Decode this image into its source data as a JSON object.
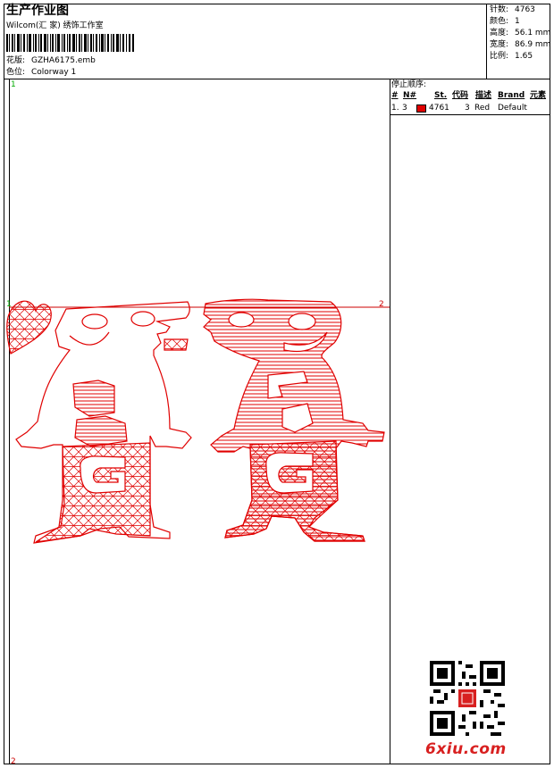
{
  "header": {
    "title": "生产作业图",
    "studio": "Wilcom(汇 家) 绣饰工作室",
    "design_label": "花版:",
    "design_file": "GZHA6175.emb",
    "colorway_label": "色位:",
    "colorway_value": "Colorway 1"
  },
  "stats": [
    {
      "label": "针数:",
      "value": "4763"
    },
    {
      "label": "颜色:",
      "value": "1"
    },
    {
      "label": "高度:",
      "value": "56.1 mm"
    },
    {
      "label": "宽度:",
      "value": "86.9 mm"
    },
    {
      "label": "比例:",
      "value": "1.65"
    }
  ],
  "stop_sequence": {
    "title": "停止顺序:",
    "columns": [
      "#",
      "N#",
      "St.",
      "代码",
      "描述",
      "Brand",
      "元素"
    ],
    "rows": [
      {
        "num": "1.",
        "needle": "3",
        "color": "#e00000",
        "stitches": "4761",
        "code": "3",
        "desc": "Red",
        "brand": "Default"
      }
    ]
  },
  "canvas_markers": {
    "top_left": "1",
    "bottom_left": "2",
    "axis_left": "1",
    "axis_right": "2"
  },
  "colors": {
    "stitch": "#e00000",
    "marker_green": "#00aa00",
    "marker_red": "#cc0000",
    "line": "#000000",
    "watermark": "#d82020"
  },
  "watermark": {
    "text": "6xiu.com"
  }
}
